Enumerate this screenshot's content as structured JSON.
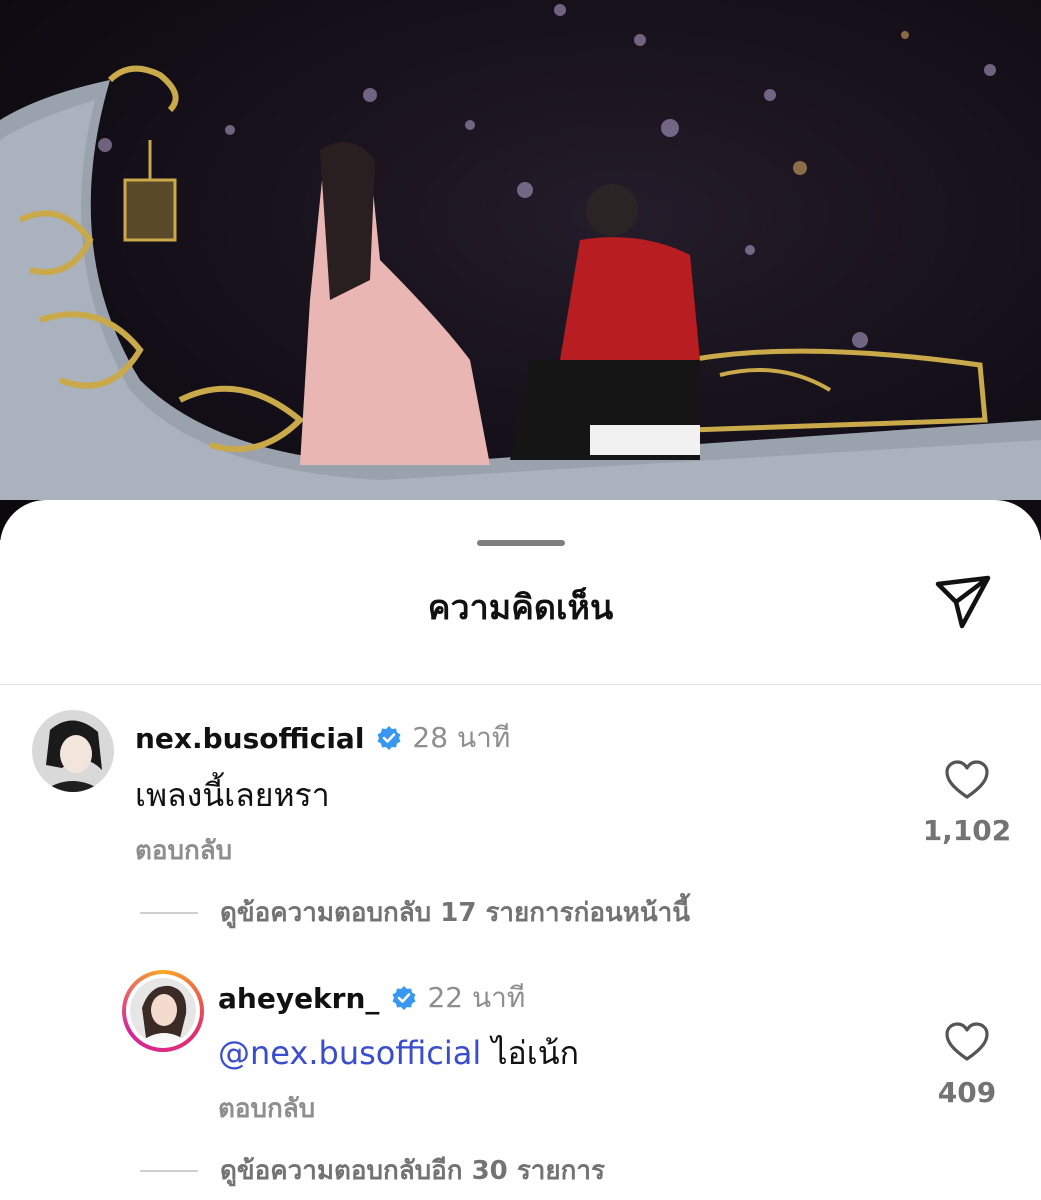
{
  "sheet": {
    "title": "ความคิดเห็น",
    "share_icon": "send-icon"
  },
  "comments": [
    {
      "username": "nex.busofficial",
      "verified": true,
      "time": "28 นาที",
      "text": "เพลงนี้เลยหรา",
      "reply_label": "ตอบกลับ",
      "likes": "1,102",
      "view_replies": "ดูข้อความตอบกลับ 17 รายการก่อนหน้านี้"
    },
    {
      "username": "aheyekrn_",
      "verified": true,
      "time": "22 นาที",
      "mention": "@nex.busofficial",
      "text": "ไอ่เน้ก",
      "reply_label": "ตอบกลับ",
      "likes": "409",
      "view_replies": "ดูข้อความตอบกลับอีก 30 รายการ"
    }
  ],
  "colors": {
    "verified": "#3897f0",
    "mention": "#3b4dcf",
    "story_ring_start": "#f9a825",
    "story_ring_end": "#d6249f"
  }
}
